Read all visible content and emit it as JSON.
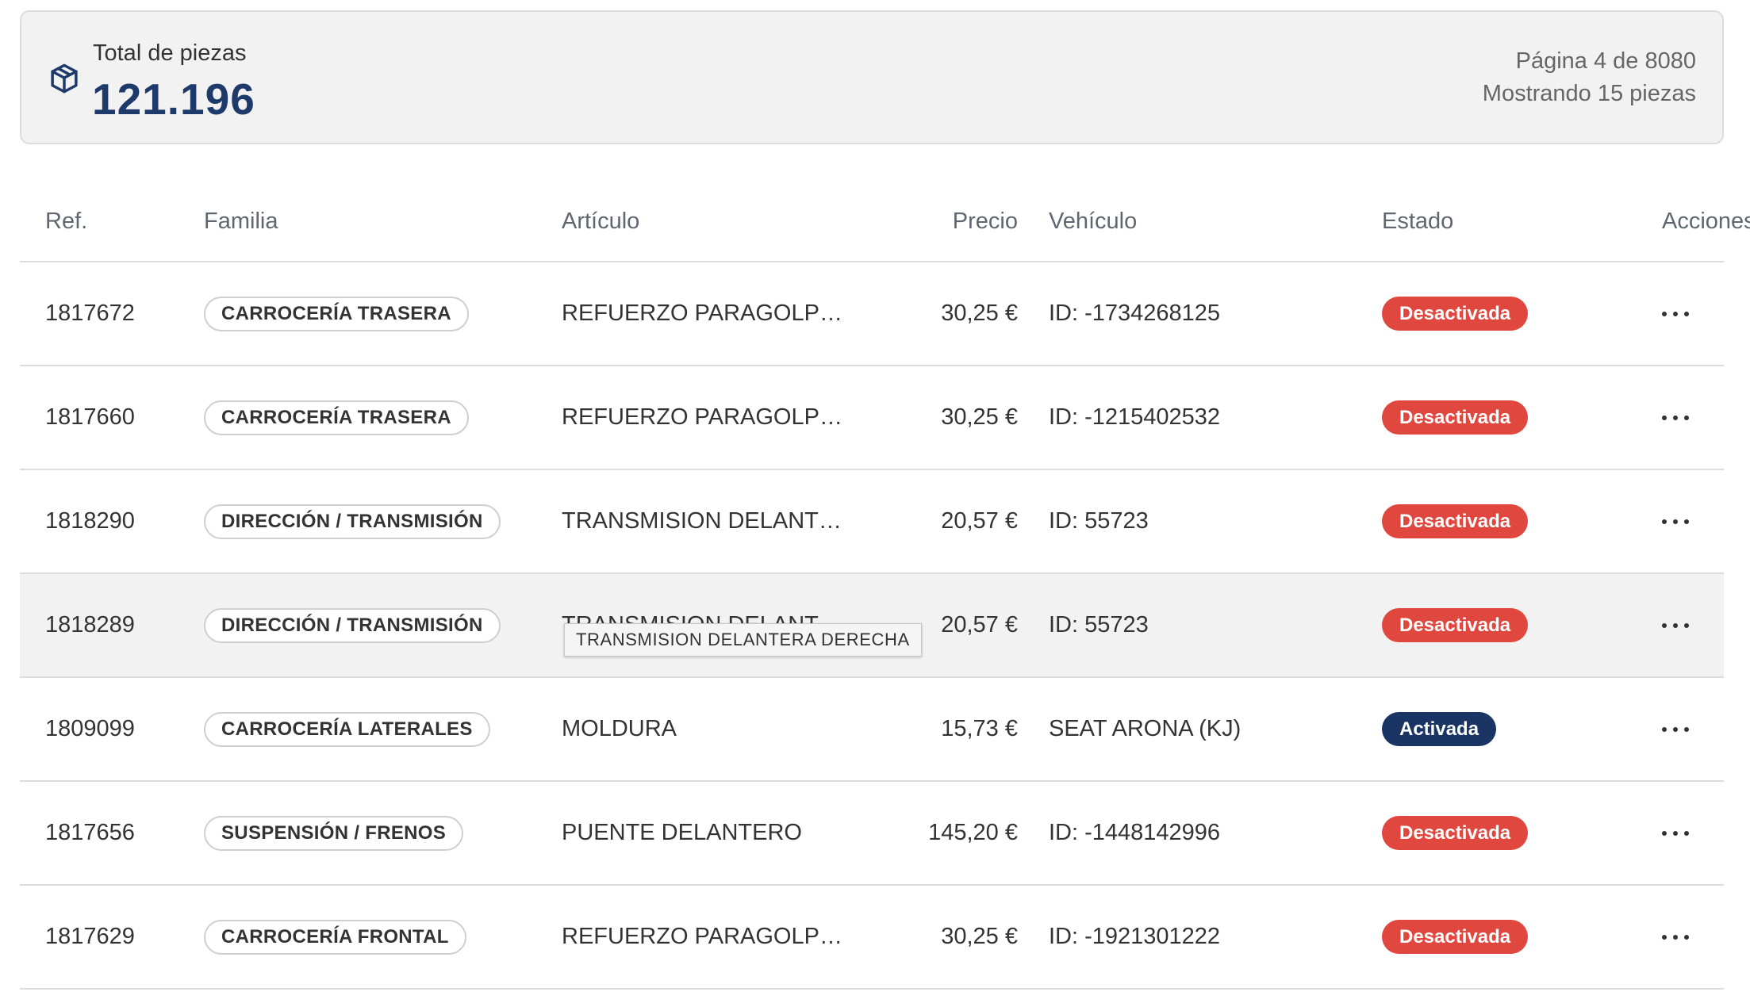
{
  "summary": {
    "label": "Total de piezas",
    "total": "121.196",
    "page_info": "Página 4 de 8080",
    "showing": "Mostrando 15 piezas",
    "icon": "box-icon"
  },
  "table": {
    "headers": {
      "ref": "Ref.",
      "family": "Familia",
      "article": "Artículo",
      "price": "Precio",
      "vehicle": "Vehículo",
      "status": "Estado",
      "actions": "Acciones"
    },
    "rows": [
      {
        "ref": "1817672",
        "family": "CARROCERÍA TRASERA",
        "article": "REFUERZO PARAGOLPES ...",
        "price": "30,25 €",
        "vehicle": "ID: -1734268125",
        "status": "Desactivada"
      },
      {
        "ref": "1817660",
        "family": "CARROCERÍA TRASERA",
        "article": "REFUERZO PARAGOLPES ...",
        "price": "30,25 €",
        "vehicle": "ID: -1215402532",
        "status": "Desactivada"
      },
      {
        "ref": "1818290",
        "family": "DIRECCIÓN / TRANSMISIÓN",
        "article": "TRANSMISION DELANTER...",
        "price": "20,57 €",
        "vehicle": "ID: 55723",
        "status": "Desactivada"
      },
      {
        "ref": "1818289",
        "family": "DIRECCIÓN / TRANSMISIÓN",
        "article": "TRANSMISION DELANTER...",
        "price": "20,57 €",
        "vehicle": "ID: 55723",
        "status": "Desactivada"
      },
      {
        "ref": "1809099",
        "family": "CARROCERÍA LATERALES",
        "article": "MOLDURA",
        "price": "15,73 €",
        "vehicle": "SEAT ARONA (KJ)",
        "status": "Activada"
      },
      {
        "ref": "1817656",
        "family": "SUSPENSIÓN / FRENOS",
        "article": "PUENTE DELANTERO",
        "price": "145,20 €",
        "vehicle": "ID: -1448142996",
        "status": "Desactivada"
      },
      {
        "ref": "1817629",
        "family": "CARROCERÍA FRONTAL",
        "article": "REFUERZO PARAGOLPES ...",
        "price": "30,25 €",
        "vehicle": "ID: -1921301222",
        "status": "Desactivada"
      }
    ]
  },
  "tooltip": {
    "text": "TRANSMISION DELANTERA DERECHA"
  },
  "colors": {
    "brand": "#1d3a6b",
    "status_off": "#e0483f",
    "status_on": "#1a3463",
    "hover_row": "#f2f2f2"
  }
}
